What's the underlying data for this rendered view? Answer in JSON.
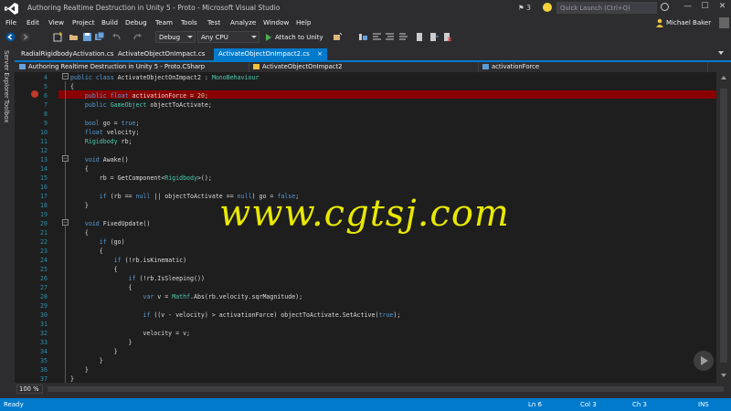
{
  "window": {
    "title": "Authoring Realtime Destruction in Unity 5 - Proto - Microsoft Visual Studio",
    "notifications": "3",
    "quick_launch_placeholder": "Quick Launch (Ctrl+Q)",
    "user_name": "Michael Baker",
    "minimize": "—",
    "maximize": "☐",
    "close": "✕"
  },
  "menu": [
    "File",
    "Edit",
    "View",
    "Project",
    "Build",
    "Debug",
    "Team",
    "Tools",
    "Test",
    "Analyze",
    "Window",
    "Help"
  ],
  "toolbar": {
    "configuration": "Debug",
    "platform": "Any CPU",
    "attach_label": "Attach to Unity"
  },
  "side_tabs": [
    "Server Explorer",
    "Toolbox"
  ],
  "doc_tabs": [
    {
      "label": "RadialRigidbodyActivation.cs",
      "active": false
    },
    {
      "label": "ActivateObjectOnImpact.cs",
      "active": false
    },
    {
      "label": "ActivateObjectOnImpact2.cs",
      "active": true
    }
  ],
  "tab_close": "×",
  "nav_bar": {
    "project": "Authoring Realtime Destruction in Unity 5 - Proto.CSharp",
    "type": "ActivateObjectOnImpact2",
    "member": "activationForce"
  },
  "code_lines": [
    {
      "n": "4",
      "t": "public class ActivateObjectOnImpact2 : MonoBehaviour"
    },
    {
      "n": "5",
      "t": "{"
    },
    {
      "n": "6",
      "t": "    public float activationForce = 20;"
    },
    {
      "n": "7",
      "t": "    public GameObject objectToActivate;"
    },
    {
      "n": "8",
      "t": ""
    },
    {
      "n": "9",
      "t": "    bool go = true;"
    },
    {
      "n": "10",
      "t": "    float velocity;"
    },
    {
      "n": "11",
      "t": "    Rigidbody rb;"
    },
    {
      "n": "12",
      "t": ""
    },
    {
      "n": "13",
      "t": "    void Awake()"
    },
    {
      "n": "14",
      "t": "    {"
    },
    {
      "n": "15",
      "t": "        rb = GetComponent<Rigidbody>();"
    },
    {
      "n": "16",
      "t": ""
    },
    {
      "n": "17",
      "t": "        if (rb == null || objectToActivate == null) go = false;"
    },
    {
      "n": "18",
      "t": "    }"
    },
    {
      "n": "19",
      "t": ""
    },
    {
      "n": "20",
      "t": "    void FixedUpdate()"
    },
    {
      "n": "21",
      "t": "    {"
    },
    {
      "n": "22",
      "t": "        if (go)"
    },
    {
      "n": "23",
      "t": "        {"
    },
    {
      "n": "24",
      "t": "            if (!rb.isKinematic)"
    },
    {
      "n": "25",
      "t": "            {"
    },
    {
      "n": "26",
      "t": "                if (!rb.IsSleeping())"
    },
    {
      "n": "27",
      "t": "                {"
    },
    {
      "n": "28",
      "t": "                    var v = Mathf.Abs(rb.velocity.sqrMagnitude);"
    },
    {
      "n": "29",
      "t": ""
    },
    {
      "n": "30",
      "t": "                    if ((v - velocity) > activationForce) objectToActivate.SetActive(true);"
    },
    {
      "n": "31",
      "t": ""
    },
    {
      "n": "32",
      "t": "                    velocity = v;"
    },
    {
      "n": "33",
      "t": "                }"
    },
    {
      "n": "34",
      "t": "            }"
    },
    {
      "n": "35",
      "t": "        }"
    },
    {
      "n": "36",
      "t": "    }"
    },
    {
      "n": "37",
      "t": "}"
    }
  ],
  "watermark": "www.cgtsj.com",
  "zoom": "100 %",
  "status": {
    "ready": "Ready",
    "line": "Ln 6",
    "col": "Col 3",
    "ch": "Ch 3",
    "mode": "INS"
  },
  "colors": {
    "accent": "#007acc",
    "breakpoint": "#8b0000",
    "keyword": "#569cd6",
    "type": "#4ec9b0",
    "watermark": "#e8e800"
  }
}
